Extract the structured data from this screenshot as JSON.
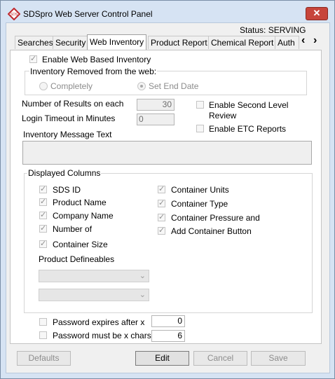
{
  "window": {
    "title": "SDSpro Web Server Control Panel",
    "close_glyph": "✕"
  },
  "status": {
    "text": "Status: SERVING"
  },
  "tabs": [
    {
      "label": "Searches"
    },
    {
      "label": "Security"
    },
    {
      "label": "Web Inventory"
    },
    {
      "label": "Product Report"
    },
    {
      "label": "Chemical Report"
    },
    {
      "label": "Auth"
    }
  ],
  "tab_scroll": {
    "left": "‹",
    "right": "›"
  },
  "inventory": {
    "enable_label": "Enable Web Based Inventory",
    "enable_checked": true,
    "removed_group_label": "Inventory Removed from the web:",
    "completely_label": "Completely",
    "set_end_date_label": "Set End Date",
    "results_label": "Number of Results on each",
    "results_value": "30",
    "timeout_label": "Login Timeout in Minutes",
    "timeout_value": "0",
    "second_level_label_1": "Enable Second Level",
    "second_level_label_2": "Review",
    "etc_label": "Enable ETC Reports",
    "message_label": "Inventory Message Text",
    "message_value": ""
  },
  "columns": {
    "group_label": "Displayed Columns",
    "left": [
      {
        "label": "SDS ID",
        "checked": true
      },
      {
        "label": "Product Name",
        "checked": true
      },
      {
        "label": "Company Name",
        "checked": true
      },
      {
        "label": "Number of",
        "checked": true
      },
      {
        "label": "Container Size",
        "checked": true
      }
    ],
    "right": [
      {
        "label": "Container Units",
        "checked": true
      },
      {
        "label": "Container Type",
        "checked": true
      },
      {
        "label": "Container Pressure and",
        "checked": true
      },
      {
        "label": "Add Container Button",
        "checked": true
      }
    ],
    "definables_label": "Product Defineables"
  },
  "password": {
    "expires_label": "Password expires after x",
    "expires_value": "0",
    "chars_label": "Password must be x chars",
    "chars_value": "6"
  },
  "buttons": {
    "defaults": "Defaults",
    "edit": "Edit",
    "cancel": "Cancel",
    "save": "Save"
  },
  "colors": {
    "title_bg": "#d6e3f3",
    "close_bg": "#c7453b"
  }
}
